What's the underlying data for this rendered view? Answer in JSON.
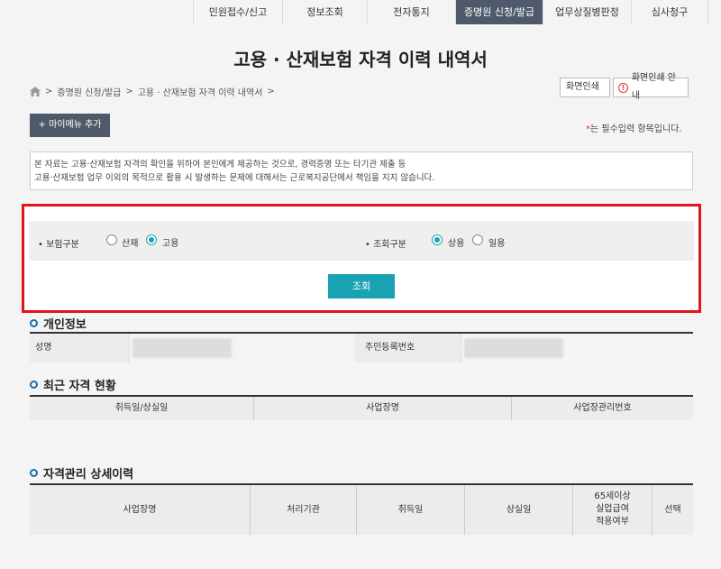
{
  "topnav": {
    "items": [
      {
        "label": "민원접수/신고"
      },
      {
        "label": "정보조회"
      },
      {
        "label": "전자통지"
      },
      {
        "label": "증명원 신청/발급"
      },
      {
        "label": "업무상질병판정"
      },
      {
        "label": "심사청구"
      }
    ]
  },
  "page": {
    "title": "고용 · 산재보험 자격 이력 내역서"
  },
  "breadcrumb": {
    "items": [
      "증명원 신청/발급",
      "고용 · 산재보험 자격 이력 내역서"
    ],
    "sep": ">"
  },
  "buttons": {
    "print": "화면인쇄",
    "print_guide": "화면인쇄 안내",
    "mymenu": "+ 마이메뉴 추가",
    "search": "조회"
  },
  "required_note": {
    "star": "*",
    "text": "는 필수입력 항목입니다."
  },
  "notice": {
    "line1": "본 자료는 고용·산재보험 자격의 확인을 위하여 본인에게 제공하는 것으로, 경력증명 또는 타기관 제출 등",
    "line2": "고용·산재보험 업무 이외의 목적으로 활용 시 발생하는 문제에 대해서는 근로복지공단에서 책임을 지지 않습니다."
  },
  "search_form": {
    "insurance_label": "• 보험구분",
    "insurance_options": [
      "산재",
      "고용"
    ],
    "insurance_selected": "고용",
    "inquiry_label": "• 조회구분",
    "inquiry_options": [
      "상용",
      "일용"
    ],
    "inquiry_selected": "상용"
  },
  "sections": {
    "personal": "개인정보",
    "current": "최근 자격 현황",
    "history": "자격관리 상세이력"
  },
  "personal_table": {
    "name_label": "성명",
    "rrn_label": "주민등록번호"
  },
  "current_table": {
    "headers": [
      "취득일/상실일",
      "사업장명",
      "사업장관리번호"
    ]
  },
  "history_table": {
    "headers": [
      "사업장명",
      "처리기관",
      "취득일",
      "상실일",
      "65세이상",
      "실업급여",
      "적용여부",
      "선택"
    ]
  },
  "colors": {
    "accent": "#1aa3b3",
    "nav_active": "#4e5a6a",
    "highlight_border": "#e0141a"
  }
}
